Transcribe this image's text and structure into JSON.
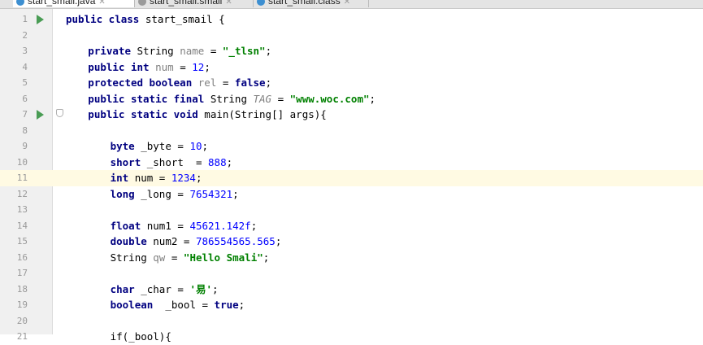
{
  "tabs": [
    {
      "label": "start_smail.java",
      "icon_color": "#3d8fd1",
      "active": true
    },
    {
      "label": "start_smail.smali",
      "icon_color": "#9a9a9a",
      "active": false
    },
    {
      "label": "start_smail.class",
      "icon_color": "#3d8fd1",
      "active": false
    }
  ],
  "editor": {
    "current_line": 11,
    "lines": [
      {
        "n": "1",
        "run": true,
        "fold": false,
        "indent": 0,
        "tokens": [
          {
            "t": "public class ",
            "c": "kw"
          },
          {
            "t": "start_smail {",
            "c": "plain"
          }
        ]
      },
      {
        "n": "2",
        "run": false,
        "fold": false,
        "indent": 0,
        "tokens": []
      },
      {
        "n": "3",
        "run": false,
        "fold": false,
        "indent": 1,
        "tokens": [
          {
            "t": "private ",
            "c": "kw"
          },
          {
            "t": "String ",
            "c": "plain"
          },
          {
            "t": "name",
            "c": "unused"
          },
          {
            "t": " = ",
            "c": "plain"
          },
          {
            "t": "\"_tlsn\"",
            "c": "str"
          },
          {
            "t": ";",
            "c": "plain"
          }
        ]
      },
      {
        "n": "4",
        "run": false,
        "fold": false,
        "indent": 1,
        "tokens": [
          {
            "t": "public int ",
            "c": "kw"
          },
          {
            "t": "num",
            "c": "unused"
          },
          {
            "t": " = ",
            "c": "plain"
          },
          {
            "t": "12",
            "c": "num"
          },
          {
            "t": ";",
            "c": "plain"
          }
        ]
      },
      {
        "n": "5",
        "run": false,
        "fold": false,
        "indent": 1,
        "tokens": [
          {
            "t": "protected boolean ",
            "c": "kw"
          },
          {
            "t": "rel",
            "c": "unused"
          },
          {
            "t": " = ",
            "c": "plain"
          },
          {
            "t": "false",
            "c": "kw"
          },
          {
            "t": ";",
            "c": "plain"
          }
        ]
      },
      {
        "n": "6",
        "run": false,
        "fold": false,
        "indent": 1,
        "tokens": [
          {
            "t": "public static final ",
            "c": "kw"
          },
          {
            "t": "String ",
            "c": "plain"
          },
          {
            "t": "TAG",
            "c": "unused italic"
          },
          {
            "t": " = ",
            "c": "plain"
          },
          {
            "t": "\"www.woc.com\"",
            "c": "str"
          },
          {
            "t": ";",
            "c": "plain"
          }
        ]
      },
      {
        "n": "7",
        "run": true,
        "fold": true,
        "indent": 1,
        "tokens": [
          {
            "t": "public static void ",
            "c": "kw"
          },
          {
            "t": "main(String[] args){",
            "c": "plain"
          }
        ]
      },
      {
        "n": "8",
        "run": false,
        "fold": false,
        "indent": 0,
        "tokens": []
      },
      {
        "n": "9",
        "run": false,
        "fold": false,
        "indent": 2,
        "tokens": [
          {
            "t": "byte ",
            "c": "kw"
          },
          {
            "t": "_byte = ",
            "c": "plain"
          },
          {
            "t": "10",
            "c": "num"
          },
          {
            "t": ";",
            "c": "plain"
          }
        ]
      },
      {
        "n": "10",
        "run": false,
        "fold": false,
        "indent": 2,
        "tokens": [
          {
            "t": "short ",
            "c": "kw"
          },
          {
            "t": "_short  = ",
            "c": "plain"
          },
          {
            "t": "888",
            "c": "num"
          },
          {
            "t": ";",
            "c": "plain"
          }
        ]
      },
      {
        "n": "11",
        "run": false,
        "fold": false,
        "indent": 2,
        "tokens": [
          {
            "t": "int ",
            "c": "kw"
          },
          {
            "t": "num = ",
            "c": "plain"
          },
          {
            "t": "1234",
            "c": "num"
          },
          {
            "t": ";",
            "c": "plain"
          }
        ]
      },
      {
        "n": "12",
        "run": false,
        "fold": false,
        "indent": 2,
        "tokens": [
          {
            "t": "long ",
            "c": "kw"
          },
          {
            "t": "_long = ",
            "c": "plain"
          },
          {
            "t": "7654321",
            "c": "num"
          },
          {
            "t": ";",
            "c": "plain"
          }
        ]
      },
      {
        "n": "13",
        "run": false,
        "fold": false,
        "indent": 0,
        "tokens": []
      },
      {
        "n": "14",
        "run": false,
        "fold": false,
        "indent": 2,
        "tokens": [
          {
            "t": "float ",
            "c": "kw"
          },
          {
            "t": "num1 = ",
            "c": "plain"
          },
          {
            "t": "45621.142f",
            "c": "num"
          },
          {
            "t": ";",
            "c": "plain"
          }
        ]
      },
      {
        "n": "15",
        "run": false,
        "fold": false,
        "indent": 2,
        "tokens": [
          {
            "t": "double ",
            "c": "kw"
          },
          {
            "t": "num2 = ",
            "c": "plain"
          },
          {
            "t": "786554565.565",
            "c": "num"
          },
          {
            "t": ";",
            "c": "plain"
          }
        ]
      },
      {
        "n": "16",
        "run": false,
        "fold": false,
        "indent": 2,
        "tokens": [
          {
            "t": "String ",
            "c": "plain"
          },
          {
            "t": "qw",
            "c": "unused"
          },
          {
            "t": " = ",
            "c": "plain"
          },
          {
            "t": "\"Hello Smali\"",
            "c": "str"
          },
          {
            "t": ";",
            "c": "plain"
          }
        ]
      },
      {
        "n": "17",
        "run": false,
        "fold": false,
        "indent": 0,
        "tokens": []
      },
      {
        "n": "18",
        "run": false,
        "fold": false,
        "indent": 2,
        "tokens": [
          {
            "t": "char ",
            "c": "kw"
          },
          {
            "t": "_char = ",
            "c": "plain"
          },
          {
            "t": "'易'",
            "c": "str"
          },
          {
            "t": ";",
            "c": "plain"
          }
        ]
      },
      {
        "n": "19",
        "run": false,
        "fold": false,
        "indent": 2,
        "tokens": [
          {
            "t": "boolean ",
            "c": "kw"
          },
          {
            "t": " _bool = ",
            "c": "plain"
          },
          {
            "t": "true",
            "c": "kw"
          },
          {
            "t": ";",
            "c": "plain"
          }
        ]
      },
      {
        "n": "20",
        "run": false,
        "fold": false,
        "indent": 0,
        "tokens": []
      },
      {
        "n": "21",
        "run": false,
        "fold": false,
        "indent": 2,
        "tokens": [
          {
            "t": "if(_bool){",
            "c": "plain"
          }
        ]
      }
    ]
  }
}
